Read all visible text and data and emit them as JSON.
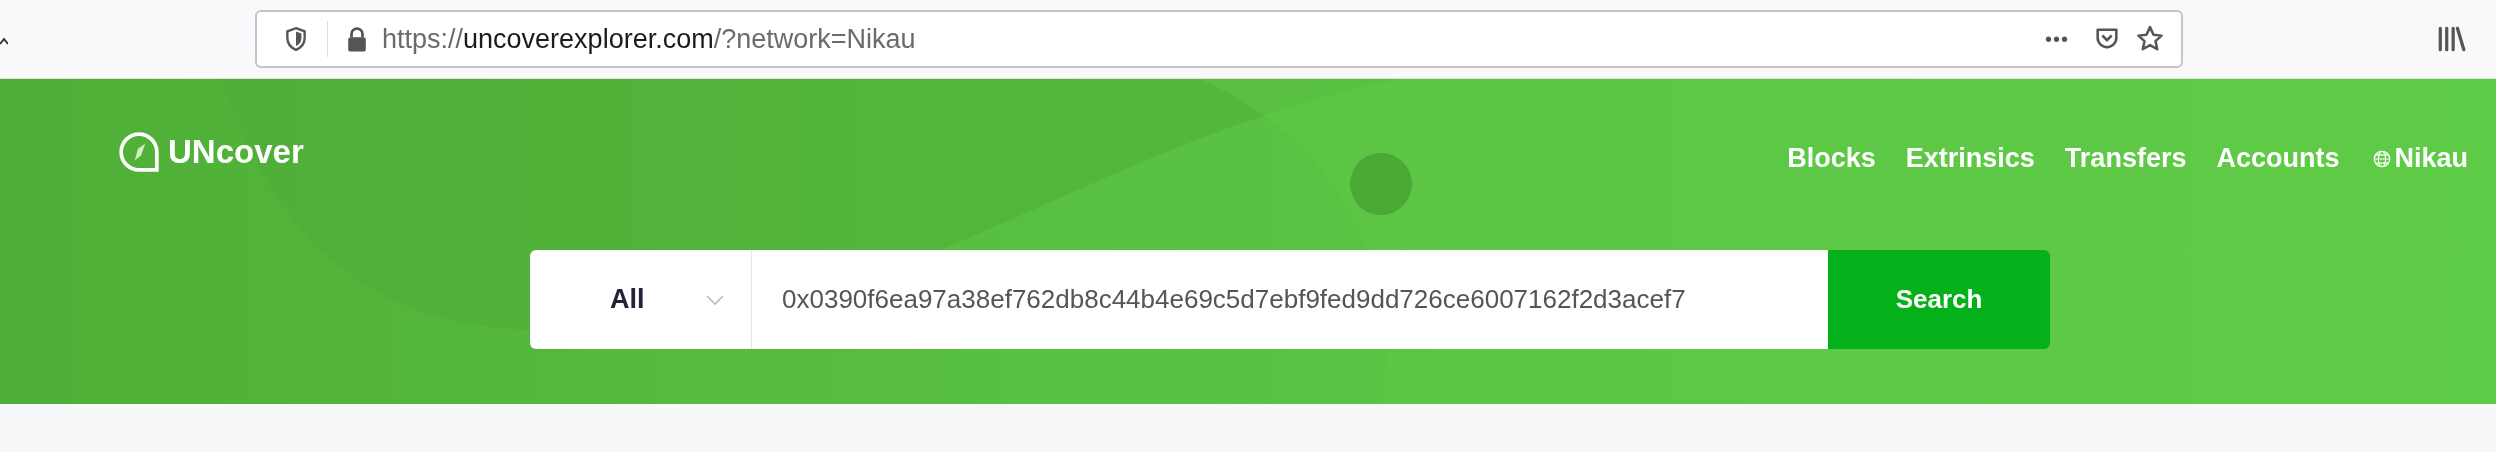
{
  "browser": {
    "url": {
      "scheme": "https://",
      "host": "uncoverexplorer.com",
      "path": "/?network=Nikau"
    },
    "more": "•••"
  },
  "header": {
    "logo": "UNcover",
    "nav": [
      {
        "label": "Blocks",
        "kind": "link"
      },
      {
        "label": "Extrinsics",
        "kind": "link"
      },
      {
        "label": "Transfers",
        "kind": "link"
      },
      {
        "label": "Accounts",
        "kind": "link"
      },
      {
        "label": "Nikau",
        "kind": "network"
      }
    ]
  },
  "search": {
    "filter": "All",
    "value": "0x0390f6ea97a38ef762db8c44b4e69c5d7ebf9fed9dd726ce6007162f2d3acef7",
    "button": "Search"
  }
}
